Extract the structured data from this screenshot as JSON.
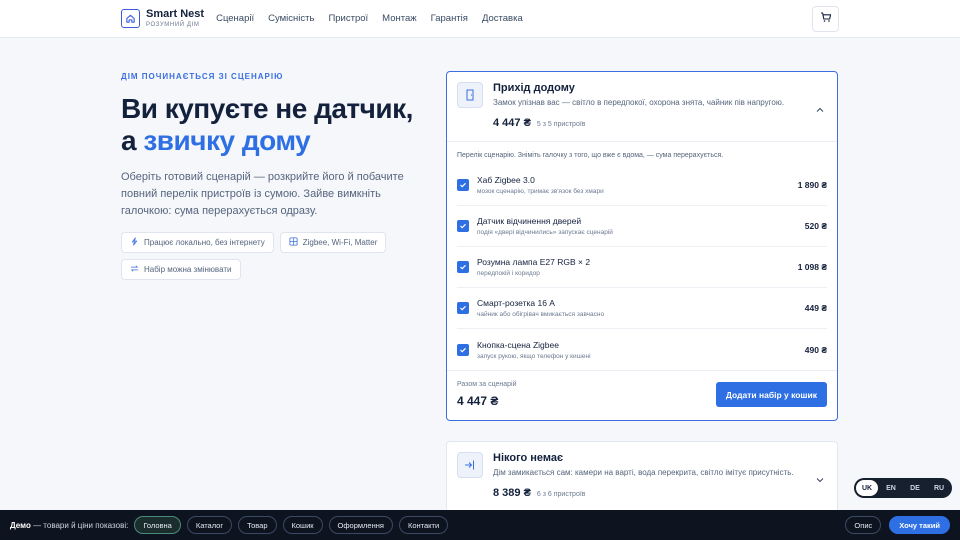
{
  "brand": {
    "name": "Smart Nest",
    "subtitle": "РОЗУМНИЙ ДІМ"
  },
  "nav": [
    "Сценарії",
    "Сумісність",
    "Пристрої",
    "Монтаж",
    "Гарантія",
    "Доставка"
  ],
  "hero": {
    "eyebrow": "ДІМ ПОЧИНАЄТЬСЯ ЗІ СЦЕНАРІЮ",
    "title_line1": "Ви купуєте не датчик,",
    "title_line2_prefix": "а ",
    "title_line2_accent": "звичку дому",
    "lead": "Оберіть готовий сценарій — розкрийте його й побачите повний перелік пристроїв із сумою. Зайве вимкніть галочкою: сума перерахується одразу.",
    "chips": [
      "Працює локально, без інтернету",
      "Zigbee, Wi‑Fi, Matter",
      "Набір можна змінювати"
    ]
  },
  "scenario1": {
    "title": "Прихід додому",
    "desc": "Замок упізнав вас — світло в передпокої, охорона знята, чайник пів напругою.",
    "price": "4 447 ₴",
    "count": "5 з 5 пристроїв",
    "hint": "Перелік сценарію. Зніміть галочку з того, що вже є вдома, — сума перерахується.",
    "items": [
      {
        "name": "Хаб Zigbee 3.0",
        "sub": "мозок сценарію, тримає зв'язок без хмари",
        "price": "1 890 ₴",
        "checked": true
      },
      {
        "name": "Датчик відчинення дверей",
        "sub": "подія «двері відчинились» запускає сценарій",
        "price": "520 ₴",
        "checked": true
      },
      {
        "name": "Розумна лампа E27 RGB × 2",
        "sub": "передпокій і коридор",
        "price": "1 098 ₴",
        "checked": true
      },
      {
        "name": "Смарт-розетка 16 А",
        "sub": "чайник або обігрівач вмикається завчасно",
        "price": "449 ₴",
        "checked": true
      },
      {
        "name": "Кнопка-сцена Zigbee",
        "sub": "запуск рукою, якщо телефон у кишені",
        "price": "490 ₴",
        "checked": true
      }
    ],
    "total_label": "Разом за сценарій",
    "total": "4 447 ₴",
    "add_label": "Додати набір у кошик"
  },
  "scenario2": {
    "title": "Нікого немає",
    "desc": "Дім замикається сам: камери на варті, вода перекрита, світло імітує присутність.",
    "price": "8 389 ₴",
    "count": "6 з 6 пристроїв"
  },
  "lang": [
    "UK",
    "EN",
    "DE",
    "RU"
  ],
  "lang_active": "UK",
  "demo": {
    "label_bold": "Демо",
    "label_rest": " — товари й ціни показові:",
    "links": [
      "Головна",
      "Каталог",
      "Товар",
      "Кошик",
      "Оформлення",
      "Контакти"
    ],
    "active": "Головна",
    "describe": "Опис",
    "cta": "Хочу такий"
  },
  "colors": {
    "accent": "#2f6fe4",
    "ink": "#14213d",
    "bar": "#0d141f"
  }
}
